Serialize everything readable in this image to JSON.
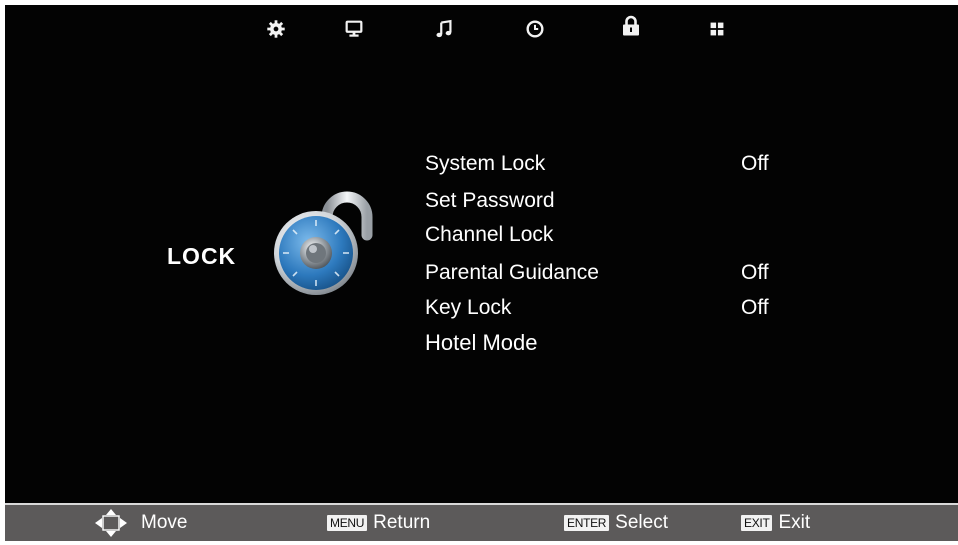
{
  "tabs": [
    {
      "icon": "gear-icon",
      "active": false
    },
    {
      "icon": "monitor-icon",
      "active": false
    },
    {
      "icon": "music-note-icon",
      "active": false
    },
    {
      "icon": "clock-icon",
      "active": false
    },
    {
      "icon": "lock-icon",
      "active": true
    },
    {
      "icon": "grid-icon",
      "active": false
    }
  ],
  "section": {
    "title": "LOCK",
    "illustration": "combination-padlock-icon"
  },
  "menu": {
    "items": [
      {
        "label": "System Lock",
        "value": "Off"
      },
      {
        "label": "Set Password",
        "value": ""
      },
      {
        "label": "Channel Lock",
        "value": ""
      },
      {
        "label": "Parental Guidance",
        "value": "Off"
      },
      {
        "label": "Key Lock",
        "value": "Off"
      },
      {
        "label": "Hotel Mode",
        "value": ""
      }
    ]
  },
  "footer": {
    "move_label": "Move",
    "return_key": "MENU",
    "return_label": "Return",
    "select_key": "ENTER",
    "select_label": "Select",
    "exit_key": "EXIT",
    "exit_label": "Exit"
  },
  "colors": {
    "background": "#030303",
    "footer": "#5c5a5a",
    "text": "#ffffff",
    "lock_dial": "#3b86c6"
  }
}
